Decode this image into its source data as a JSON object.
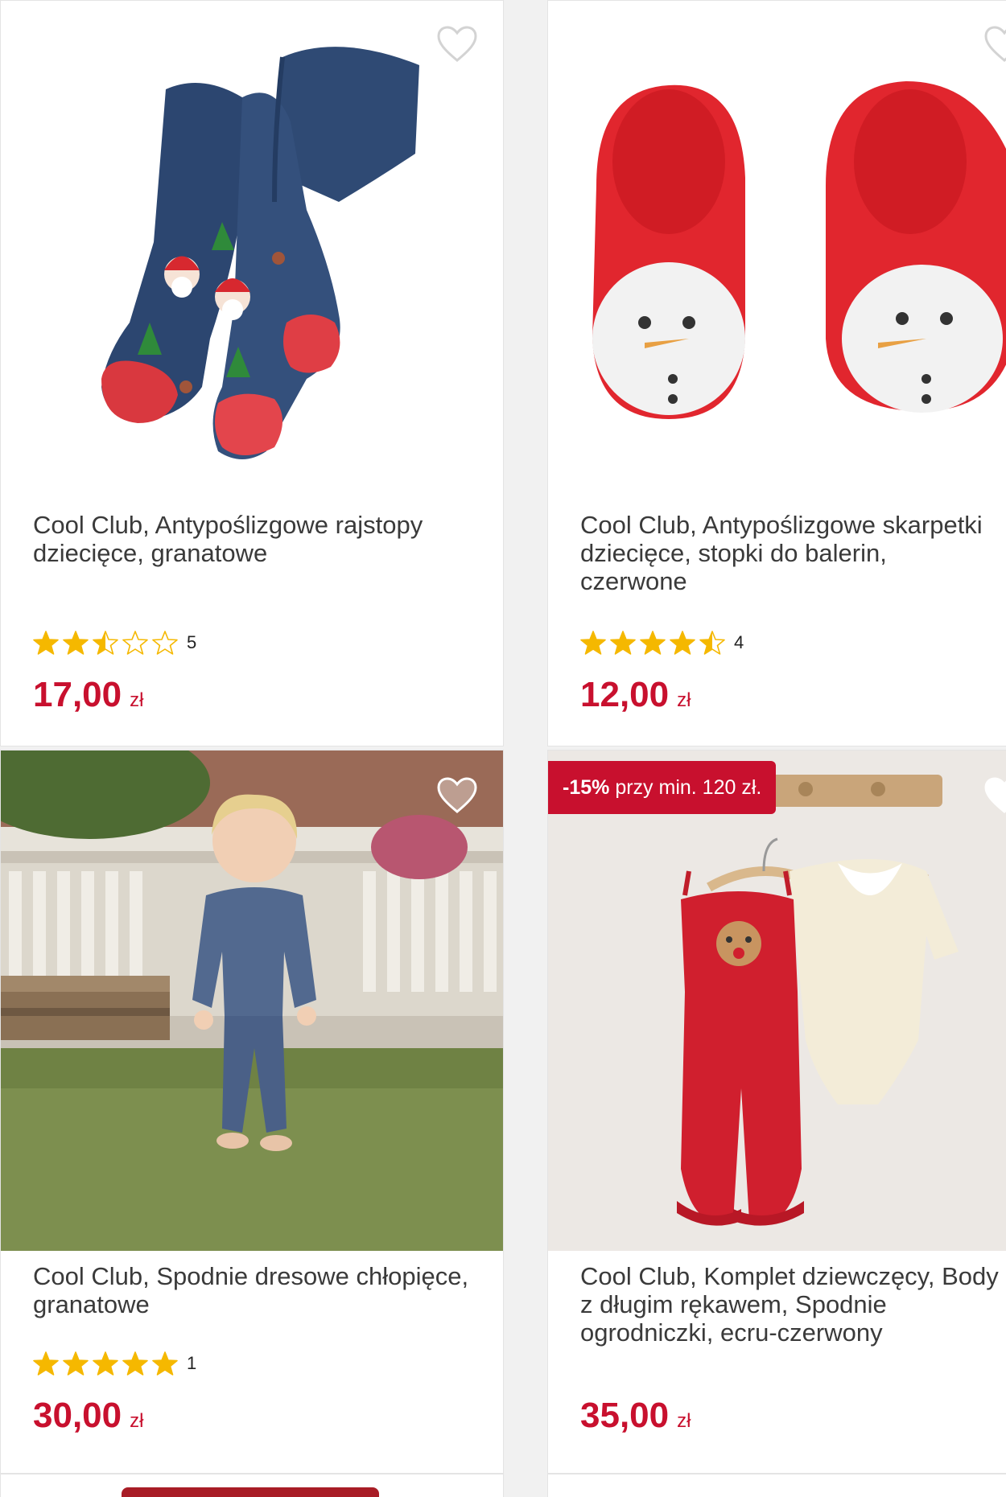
{
  "products": [
    {
      "title": "Cool Club, Antypoślizgowe rajstopy dziecięce, granatowe",
      "rating": 2.5,
      "rating_count": "5",
      "price": "17,00",
      "currency": "zł",
      "promo_text": "",
      "favorite_icon": "heart-outline-icon"
    },
    {
      "title": "Cool Club, Antypoślizgowe skarpetki dziecięce, stopki do balerin, czerwone",
      "rating": 4.5,
      "rating_count": "4",
      "price": "12,00",
      "currency": "zł",
      "promo_text": "",
      "favorite_icon": "heart-outline-icon"
    },
    {
      "title": "Cool Club, Spodnie dresowe chłopięce, granatowe",
      "rating": 5,
      "rating_count": "1",
      "price": "30,00",
      "currency": "zł",
      "promo_text": "",
      "favorite_icon": "heart-outline-icon"
    },
    {
      "title": "Cool Club, Komplet dziewczęcy, Body z długim rękawem, Spodnie ogrodniczki, ecru-czerwony",
      "rating": null,
      "rating_count": "",
      "price": "35,00",
      "currency": "zł",
      "promo_bold": "-15%",
      "promo_text": "przy min. 120 zł.",
      "favorite_icon": "heart-outline-icon"
    }
  ],
  "colors": {
    "price": "#c8102e",
    "promo_bg": "#c8102e",
    "star": "#f5b800"
  }
}
